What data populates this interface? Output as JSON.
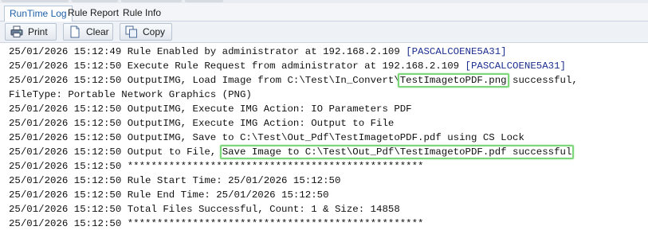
{
  "tabs": [
    {
      "label": "RunTime Log",
      "active": true
    },
    {
      "label": "Rule Report",
      "active": false
    },
    {
      "label": "Rule Info",
      "active": false
    }
  ],
  "toolbar": {
    "print_label": "Print",
    "clear_label": "Clear",
    "copy_label": "Copy"
  },
  "log": {
    "l1": {
      "text": "25/01/2026 15:12:49 Rule Enabled by administrator at 192.168.2.109 ",
      "host": "[PASCALCOENE5A31]"
    },
    "l2": {
      "text": "25/01/2026 15:12:50 Execute Rule Request from administrator at 192.168.2.109 ",
      "host": "[PASCALCOENE5A31]"
    },
    "l3": {
      "pre": "25/01/2026 15:12:50 OutputIMG, Load Image from C:\\Test\\In_Convert\\",
      "hl": "TestImagetoPDF.png",
      "post": " successful,"
    },
    "l4": "FileType: Portable Network Graphics (PNG)",
    "l5": "25/01/2026 15:12:50 OutputIMG, Execute IMG Action: IO Parameters PDF",
    "l6": "25/01/2026 15:12:50 OutputIMG, Execute IMG Action: Output to File",
    "l7": "25/01/2026 15:12:50 OutputIMG, Save to C:\\Test\\Out_Pdf\\TestImagetoPDF.pdf using CS Lock",
    "l8": {
      "pre": "25/01/2026 15:12:50 Output to File, ",
      "hl": "Save Image to C:\\Test\\Out_Pdf\\TestImagetoPDF.pdf successful"
    },
    "l9": "25/01/2026 15:12:50 **************************************************",
    "l10": "25/01/2026 15:12:50 Rule Start Time: 25/01/2026 15:12:50",
    "l11": "25/01/2026 15:12:50 Rule End Time: 25/01/2026 15:12:50",
    "l12": "25/01/2026 15:12:50 Total Files Successful, Count: 1 & Size: 14858",
    "l13": "25/01/2026 15:12:50 **************************************************"
  },
  "icons": {
    "print": "printer-icon",
    "clear": "document-icon",
    "copy": "copy-icon"
  },
  "colors": {
    "highlight_border": "#7ed67a",
    "active_tab_text": "#1f5fa8",
    "host_text": "#1c2f8f"
  }
}
